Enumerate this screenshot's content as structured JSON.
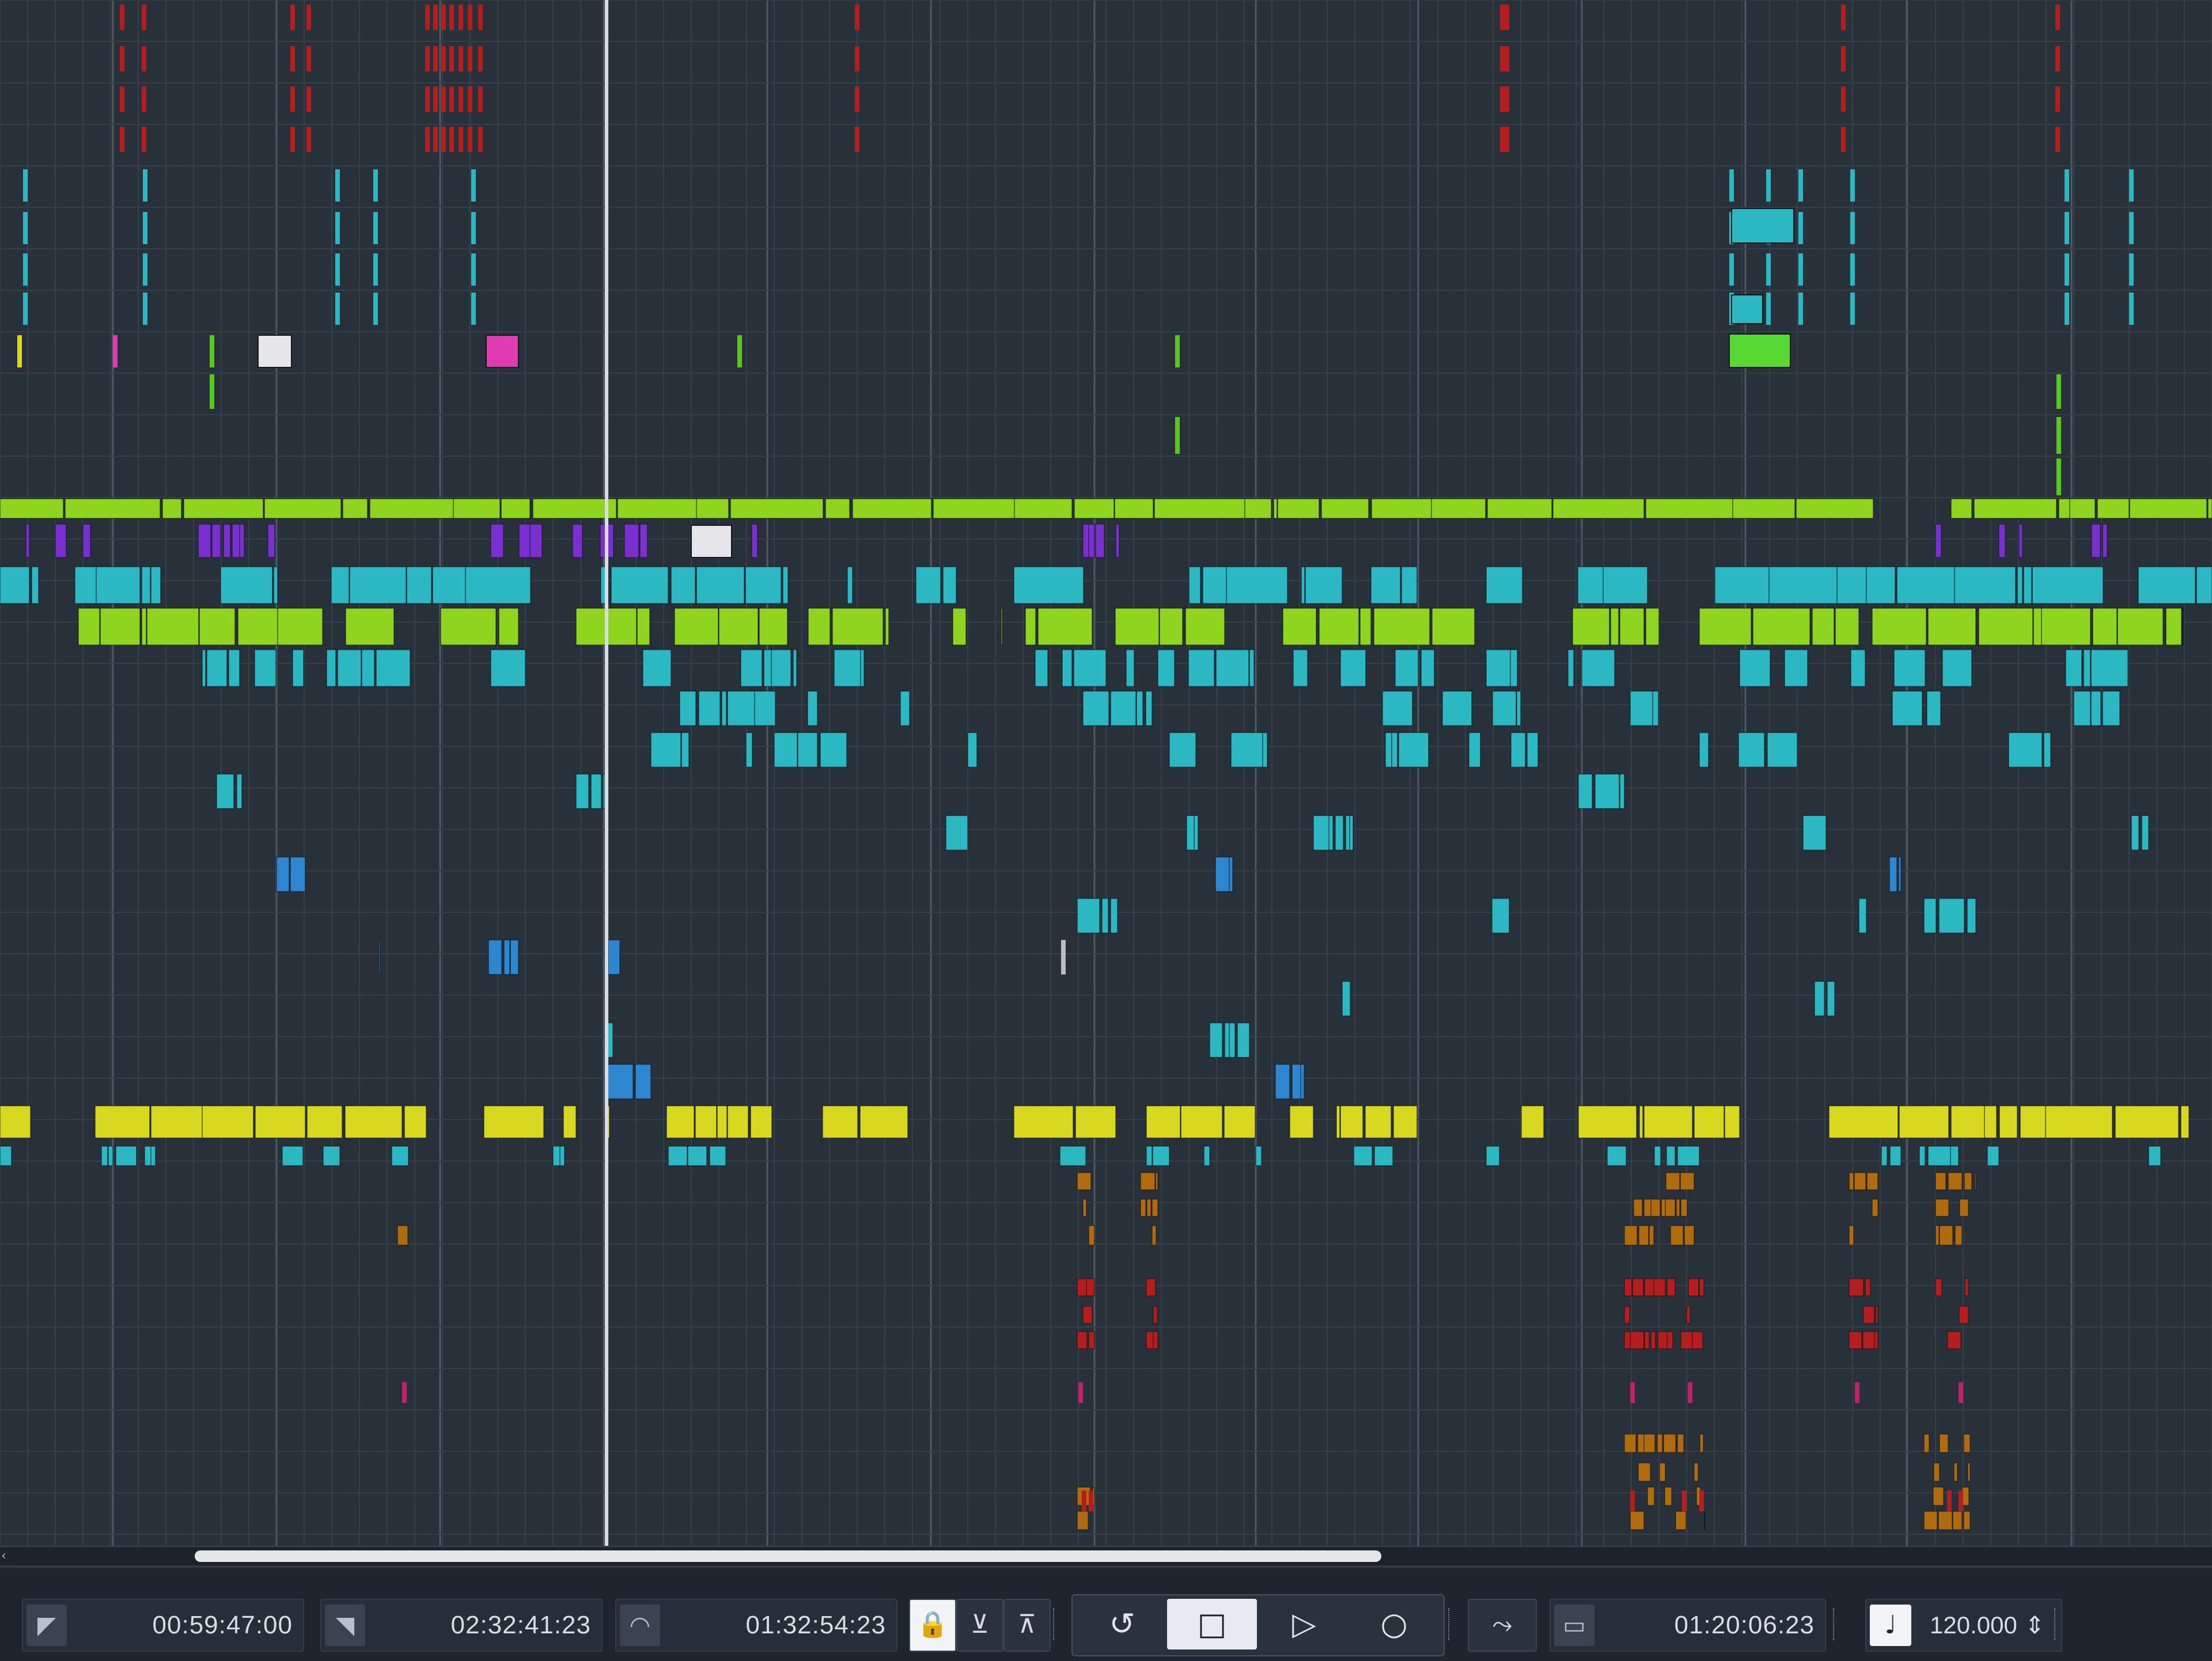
{
  "transport": {
    "left_locator": "00:59:47:00",
    "right_locator": "02:32:41:23",
    "range_length": "01:32:54:23",
    "position": "01:20:06:23",
    "tempo": "120.000"
  },
  "icons": {
    "left_locator_button": "left-locator-icon",
    "right_locator_button": "right-locator-icon",
    "length_button": "range-length-icon",
    "lock": "lock-icon",
    "punch_in": "punch-in-icon",
    "punch_out": "punch-out-icon",
    "cycle": "cycle-icon",
    "stop": "stop-icon",
    "play": "play-icon",
    "record": "record-icon",
    "sync": "sync-icon",
    "time_display": "time-display-icon",
    "tempo": "tempo-icon",
    "scroll_left": "scroll-left-arrow-icon"
  },
  "colors": {
    "arranger_bg": "#283039",
    "grid_major": "#505a66",
    "grid_minor": "#36404c",
    "playhead": "#d9dde3",
    "red_clip": "#b51e1e",
    "teal_clip": "#2bb8c2",
    "lime_clip": "#8fd41f",
    "yellow_clip": "#d7d81f",
    "purple_clip": "#7a2fd1",
    "blue_clip": "#2e86d0",
    "orange_clip": "#b06b0e",
    "magenta_clip": "#e13bb4"
  }
}
